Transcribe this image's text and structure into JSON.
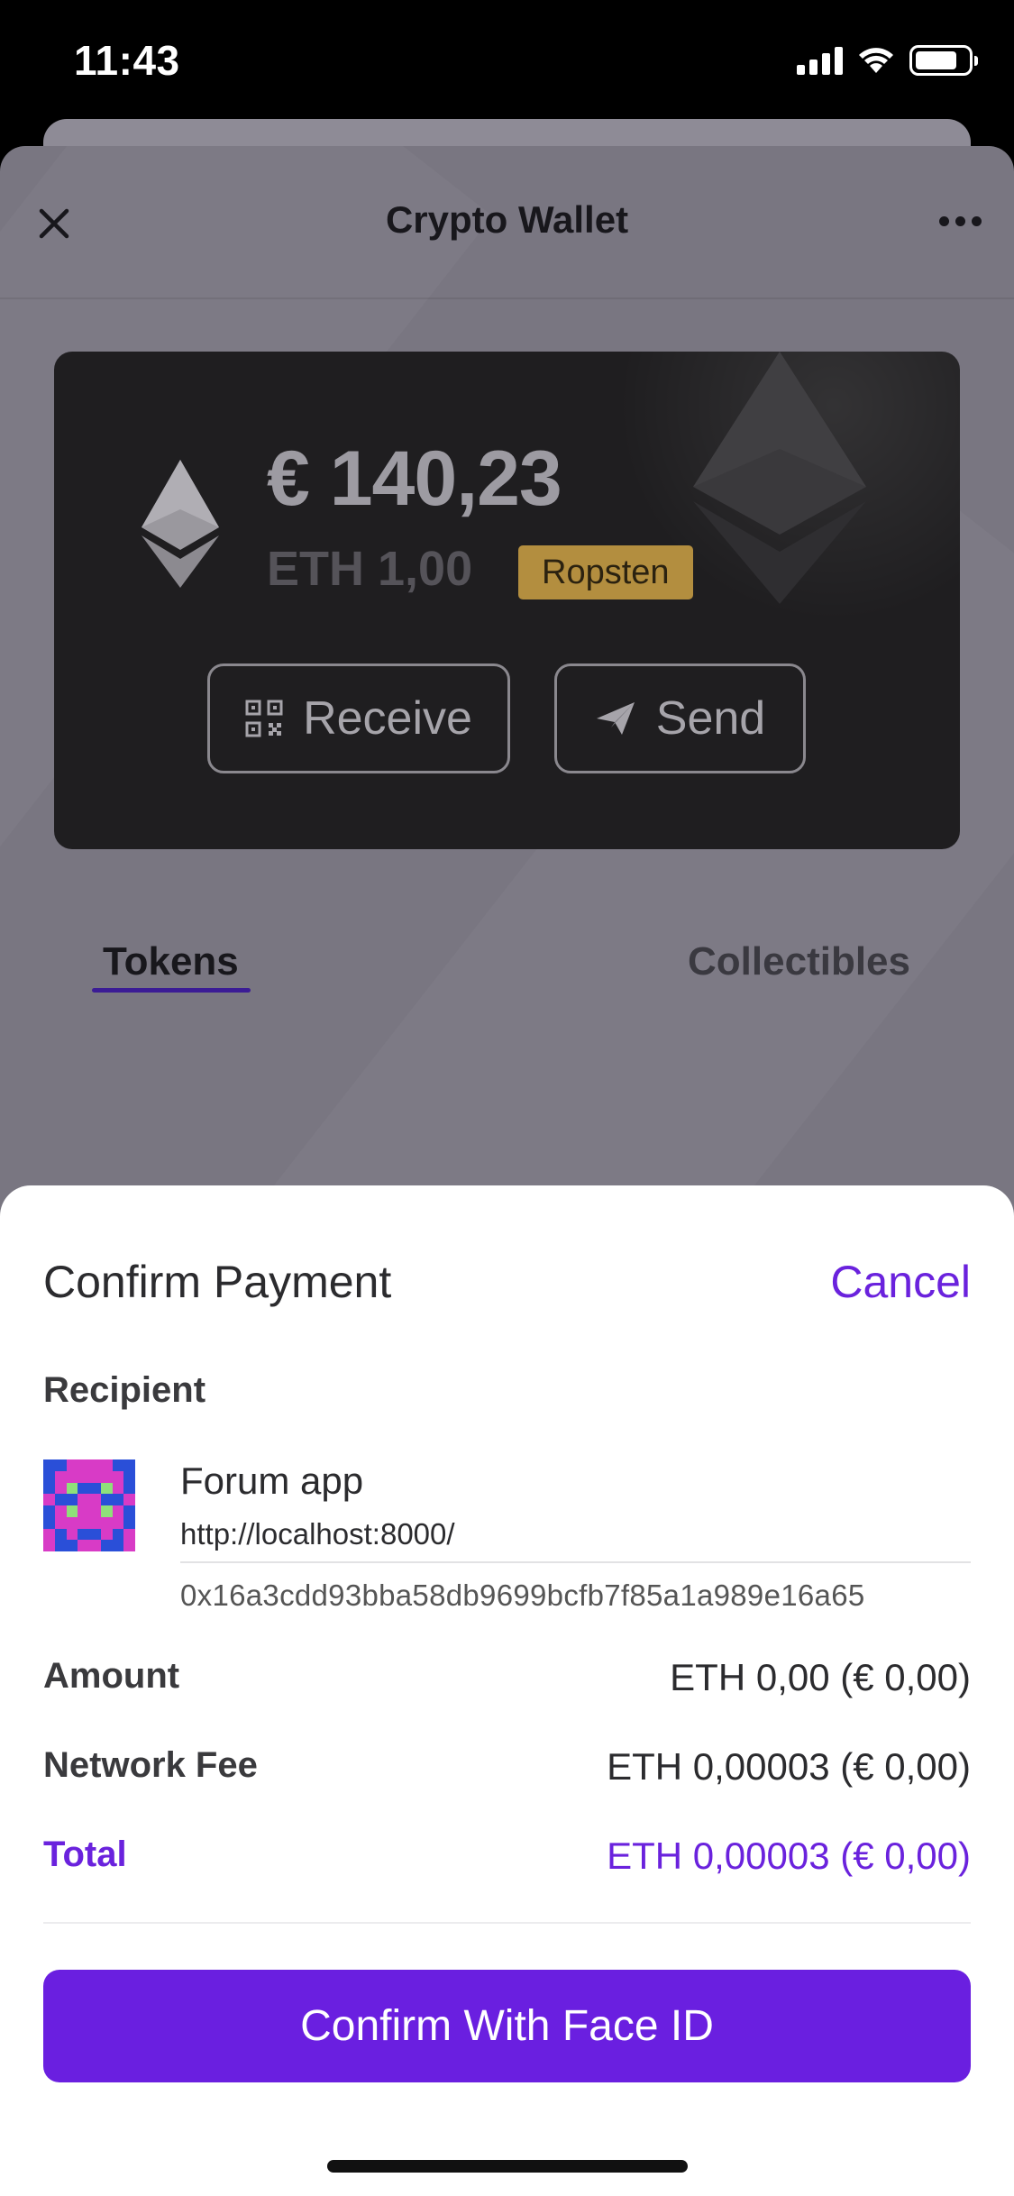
{
  "status_bar": {
    "time": "11:43"
  },
  "nav": {
    "title": "Crypto Wallet"
  },
  "wallet": {
    "fiat_balance": "€ 140,23",
    "eth_balance": "ETH 1,00",
    "network": "Ropsten",
    "receive_label": "Receive",
    "send_label": "Send"
  },
  "tabs": [
    {
      "label": "Tokens",
      "active": true
    },
    {
      "label": "Collectibles",
      "active": false
    }
  ],
  "confirm": {
    "title": "Confirm Payment",
    "cancel_label": "Cancel",
    "recipient_label": "Recipient",
    "recipient": {
      "name": "Forum app",
      "url": "http://localhost:8000/",
      "address": "0x16a3cdd93bba58db9699bcfb7f85a1a989e16a65"
    },
    "rows": [
      {
        "label": "Amount",
        "value": "ETH 0,00 (€ 0,00)"
      },
      {
        "label": "Network Fee",
        "value": "ETH 0,00003 (€ 0,00)"
      },
      {
        "label": "Total",
        "value": "ETH 0,00003 (€ 0,00)"
      }
    ],
    "button_label": "Confirm With Face ID"
  },
  "colors": {
    "accent": "#6a22dd",
    "badge": "#b38e3f",
    "card": "#1f1e20",
    "overlay": "#797681"
  },
  "icons": {
    "close": "close-icon",
    "more": "more-icon",
    "ethereum": "ethereum-icon",
    "qr": "qr-code-icon",
    "send": "paper-plane-icon"
  }
}
